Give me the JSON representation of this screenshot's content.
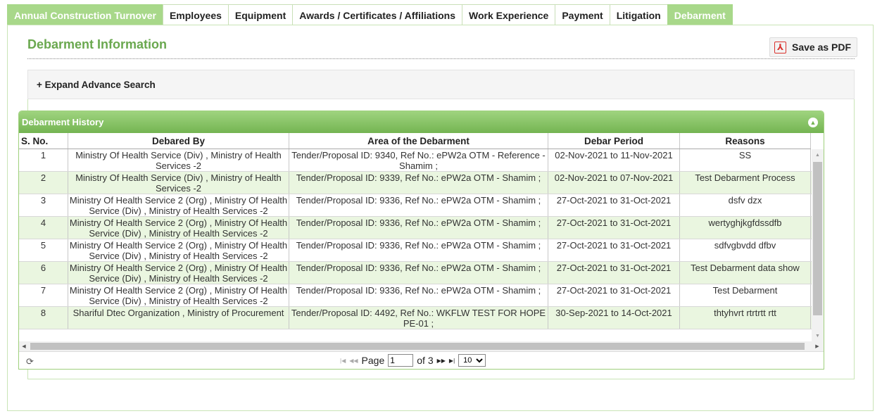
{
  "tabs": [
    {
      "label": "Annual Construction Turnover",
      "active": true
    },
    {
      "label": "Employees",
      "active": false
    },
    {
      "label": "Equipment",
      "active": false
    },
    {
      "label": "Awards / Certificates / Affiliations",
      "active": false
    },
    {
      "label": "Work Experience",
      "active": false
    },
    {
      "label": "Payment",
      "active": false
    },
    {
      "label": "Litigation",
      "active": false
    },
    {
      "label": "Debarment",
      "active": true
    }
  ],
  "page": {
    "title": "Debarment Information",
    "save_pdf_label": "Save as PDF",
    "expand_search_label": "+ Expand Advance Search"
  },
  "grid": {
    "title": "Debarment History",
    "columns": [
      "S. No.",
      "Debared By",
      "Area of the Debarment",
      "Debar Period",
      "Reasons"
    ],
    "rows": [
      {
        "sno": "1",
        "by": "Ministry Of Health Service (Div) , Ministry of Health Services -2",
        "area": "Tender/Proposal ID: 9340, Ref No.: ePW2a OTM - Reference - Shamim ;",
        "period": "02-Nov-2021 to 11-Nov-2021",
        "reason": "SS"
      },
      {
        "sno": "2",
        "by": "Ministry Of Health Service (Div) , Ministry of Health Services -2",
        "area": "Tender/Proposal ID: 9339, Ref No.: ePW2a OTM - Shamim ;",
        "period": "02-Nov-2021 to 07-Nov-2021",
        "reason": "Test Debarment Process"
      },
      {
        "sno": "3",
        "by": "Ministry Of Health Service 2 (Org) , Ministry Of Health Service (Div) , Ministry of Health Services -2",
        "area": "Tender/Proposal ID: 9336, Ref No.: ePW2a OTM - Shamim ;",
        "period": "27-Oct-2021 to 31-Oct-2021",
        "reason": "dsfv dzx"
      },
      {
        "sno": "4",
        "by": "Ministry Of Health Service 2 (Org) , Ministry Of Health Service (Div) , Ministry of Health Services -2",
        "area": "Tender/Proposal ID: 9336, Ref No.: ePW2a OTM - Shamim ;",
        "period": "27-Oct-2021 to 31-Oct-2021",
        "reason": "wertyghjkgfdssdfb"
      },
      {
        "sno": "5",
        "by": "Ministry Of Health Service 2 (Org) , Ministry Of Health Service (Div) , Ministry of Health Services -2",
        "area": "Tender/Proposal ID: 9336, Ref No.: ePW2a OTM - Shamim ;",
        "period": "27-Oct-2021 to 31-Oct-2021",
        "reason": "sdfvgbvdd dfbv"
      },
      {
        "sno": "6",
        "by": "Ministry Of Health Service 2 (Org) , Ministry Of Health Service (Div) , Ministry of Health Services -2",
        "area": "Tender/Proposal ID: 9336, Ref No.: ePW2a OTM - Shamim ;",
        "period": "27-Oct-2021 to 31-Oct-2021",
        "reason": "Test Debarment data show"
      },
      {
        "sno": "7",
        "by": "Ministry Of Health Service 2 (Org) , Ministry Of Health Service (Div) , Ministry of Health Services -2",
        "area": "Tender/Proposal ID: 9336, Ref No.: ePW2a OTM - Shamim ;",
        "period": "27-Oct-2021 to 31-Oct-2021",
        "reason": "Test Debarment"
      },
      {
        "sno": "8",
        "by": "Shariful Dtec Organization , Ministry of Procurement",
        "area": "Tender/Proposal ID: 4492, Ref No.: WKFLW TEST FOR HOPE PE-01 ;",
        "period": "30-Sep-2021 to 14-Oct-2021",
        "reason": "thtyhvrt rtrtrtt rtt"
      }
    ]
  },
  "pager": {
    "page_label": "Page",
    "page_value": "1",
    "of_label": "of 3",
    "rows_per_page": "10"
  }
}
